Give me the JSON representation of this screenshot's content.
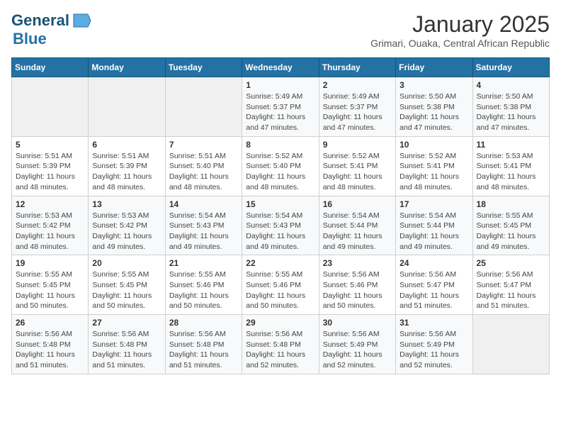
{
  "logo": {
    "line1": "General",
    "line2": "Blue",
    "icon": "▶"
  },
  "title": "January 2025",
  "location": "Grimari, Ouaka, Central African Republic",
  "headers": [
    "Sunday",
    "Monday",
    "Tuesday",
    "Wednesday",
    "Thursday",
    "Friday",
    "Saturday"
  ],
  "weeks": [
    [
      {
        "day": "",
        "info": ""
      },
      {
        "day": "",
        "info": ""
      },
      {
        "day": "",
        "info": ""
      },
      {
        "day": "1",
        "info": "Sunrise: 5:49 AM\nSunset: 5:37 PM\nDaylight: 11 hours and 47 minutes."
      },
      {
        "day": "2",
        "info": "Sunrise: 5:49 AM\nSunset: 5:37 PM\nDaylight: 11 hours and 47 minutes."
      },
      {
        "day": "3",
        "info": "Sunrise: 5:50 AM\nSunset: 5:38 PM\nDaylight: 11 hours and 47 minutes."
      },
      {
        "day": "4",
        "info": "Sunrise: 5:50 AM\nSunset: 5:38 PM\nDaylight: 11 hours and 47 minutes."
      }
    ],
    [
      {
        "day": "5",
        "info": "Sunrise: 5:51 AM\nSunset: 5:39 PM\nDaylight: 11 hours and 48 minutes."
      },
      {
        "day": "6",
        "info": "Sunrise: 5:51 AM\nSunset: 5:39 PM\nDaylight: 11 hours and 48 minutes."
      },
      {
        "day": "7",
        "info": "Sunrise: 5:51 AM\nSunset: 5:40 PM\nDaylight: 11 hours and 48 minutes."
      },
      {
        "day": "8",
        "info": "Sunrise: 5:52 AM\nSunset: 5:40 PM\nDaylight: 11 hours and 48 minutes."
      },
      {
        "day": "9",
        "info": "Sunrise: 5:52 AM\nSunset: 5:41 PM\nDaylight: 11 hours and 48 minutes."
      },
      {
        "day": "10",
        "info": "Sunrise: 5:52 AM\nSunset: 5:41 PM\nDaylight: 11 hours and 48 minutes."
      },
      {
        "day": "11",
        "info": "Sunrise: 5:53 AM\nSunset: 5:41 PM\nDaylight: 11 hours and 48 minutes."
      }
    ],
    [
      {
        "day": "12",
        "info": "Sunrise: 5:53 AM\nSunset: 5:42 PM\nDaylight: 11 hours and 48 minutes."
      },
      {
        "day": "13",
        "info": "Sunrise: 5:53 AM\nSunset: 5:42 PM\nDaylight: 11 hours and 49 minutes."
      },
      {
        "day": "14",
        "info": "Sunrise: 5:54 AM\nSunset: 5:43 PM\nDaylight: 11 hours and 49 minutes."
      },
      {
        "day": "15",
        "info": "Sunrise: 5:54 AM\nSunset: 5:43 PM\nDaylight: 11 hours and 49 minutes."
      },
      {
        "day": "16",
        "info": "Sunrise: 5:54 AM\nSunset: 5:44 PM\nDaylight: 11 hours and 49 minutes."
      },
      {
        "day": "17",
        "info": "Sunrise: 5:54 AM\nSunset: 5:44 PM\nDaylight: 11 hours and 49 minutes."
      },
      {
        "day": "18",
        "info": "Sunrise: 5:55 AM\nSunset: 5:45 PM\nDaylight: 11 hours and 49 minutes."
      }
    ],
    [
      {
        "day": "19",
        "info": "Sunrise: 5:55 AM\nSunset: 5:45 PM\nDaylight: 11 hours and 50 minutes."
      },
      {
        "day": "20",
        "info": "Sunrise: 5:55 AM\nSunset: 5:45 PM\nDaylight: 11 hours and 50 minutes."
      },
      {
        "day": "21",
        "info": "Sunrise: 5:55 AM\nSunset: 5:46 PM\nDaylight: 11 hours and 50 minutes."
      },
      {
        "day": "22",
        "info": "Sunrise: 5:55 AM\nSunset: 5:46 PM\nDaylight: 11 hours and 50 minutes."
      },
      {
        "day": "23",
        "info": "Sunrise: 5:56 AM\nSunset: 5:46 PM\nDaylight: 11 hours and 50 minutes."
      },
      {
        "day": "24",
        "info": "Sunrise: 5:56 AM\nSunset: 5:47 PM\nDaylight: 11 hours and 51 minutes."
      },
      {
        "day": "25",
        "info": "Sunrise: 5:56 AM\nSunset: 5:47 PM\nDaylight: 11 hours and 51 minutes."
      }
    ],
    [
      {
        "day": "26",
        "info": "Sunrise: 5:56 AM\nSunset: 5:48 PM\nDaylight: 11 hours and 51 minutes."
      },
      {
        "day": "27",
        "info": "Sunrise: 5:56 AM\nSunset: 5:48 PM\nDaylight: 11 hours and 51 minutes."
      },
      {
        "day": "28",
        "info": "Sunrise: 5:56 AM\nSunset: 5:48 PM\nDaylight: 11 hours and 51 minutes."
      },
      {
        "day": "29",
        "info": "Sunrise: 5:56 AM\nSunset: 5:48 PM\nDaylight: 11 hours and 52 minutes."
      },
      {
        "day": "30",
        "info": "Sunrise: 5:56 AM\nSunset: 5:49 PM\nDaylight: 11 hours and 52 minutes."
      },
      {
        "day": "31",
        "info": "Sunrise: 5:56 AM\nSunset: 5:49 PM\nDaylight: 11 hours and 52 minutes."
      },
      {
        "day": "",
        "info": ""
      }
    ]
  ]
}
